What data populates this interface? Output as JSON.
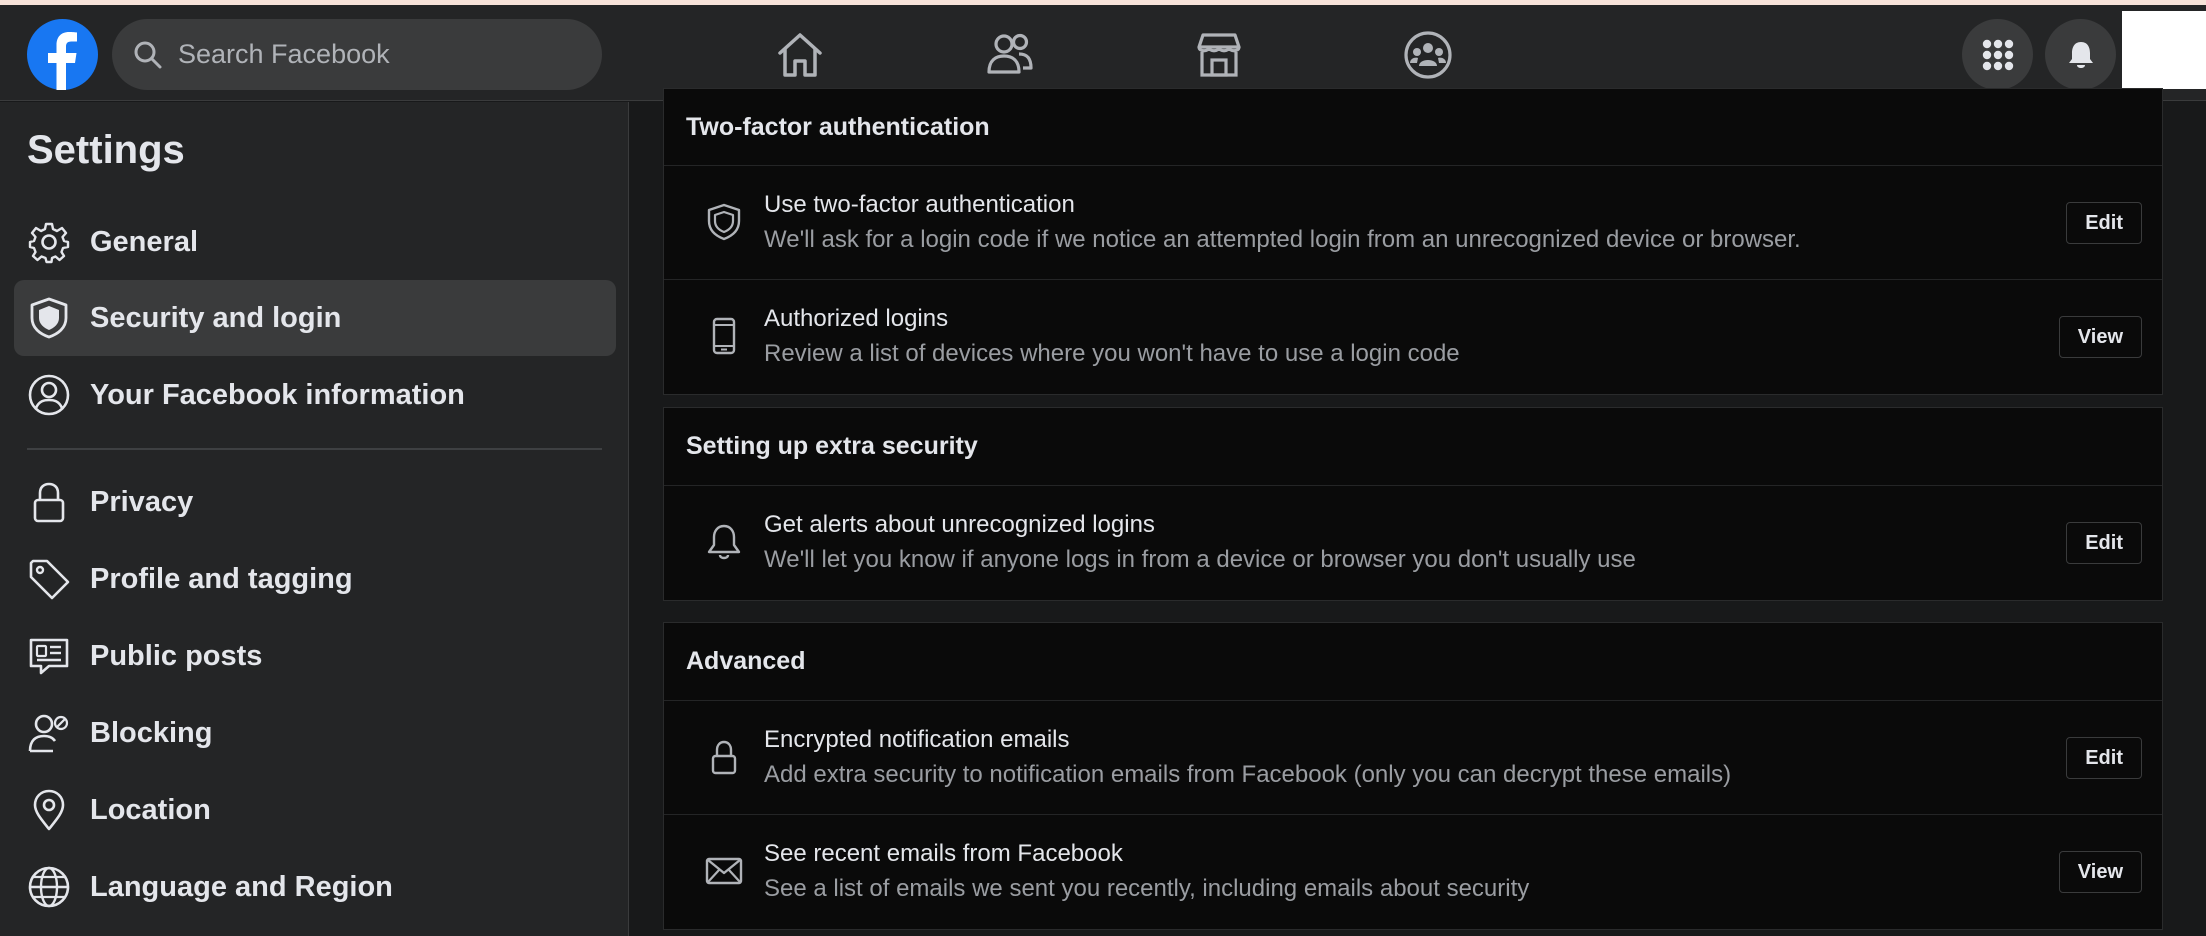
{
  "header": {
    "search_placeholder": "Search Facebook",
    "nav_icons": [
      "home-icon",
      "friends-icon",
      "marketplace-icon",
      "groups-icon"
    ],
    "right_icons": [
      "menu-grid-icon",
      "notifications-bell-icon"
    ]
  },
  "sidebar": {
    "title": "Settings",
    "items": [
      {
        "label": "General",
        "icon": "gear-icon"
      },
      {
        "label": "Security and login",
        "icon": "shield-icon",
        "active": true
      },
      {
        "label": "Your Facebook information",
        "icon": "user-circle-icon"
      },
      {
        "label": "Privacy",
        "icon": "lock-icon"
      },
      {
        "label": "Profile and tagging",
        "icon": "tag-icon"
      },
      {
        "label": "Public posts",
        "icon": "public-posts-icon"
      },
      {
        "label": "Blocking",
        "icon": "block-user-icon"
      },
      {
        "label": "Location",
        "icon": "location-pin-icon"
      },
      {
        "label": "Language and Region",
        "icon": "globe-icon"
      }
    ]
  },
  "sections": [
    {
      "title": "Two-factor authentication",
      "rows": [
        {
          "icon": "shield-icon",
          "title": "Use two-factor authentication",
          "desc": "We'll ask for a login code if we notice an attempted login from an unrecognized device or browser.",
          "button": "Edit"
        },
        {
          "icon": "phone-icon",
          "title": "Authorized logins",
          "desc": "Review a list of devices where you won't have to use a login code",
          "button": "View"
        }
      ]
    },
    {
      "title": "Setting up extra security",
      "rows": [
        {
          "icon": "bell-icon",
          "title": "Get alerts about unrecognized logins",
          "desc": "We'll let you know if anyone logs in from a device or browser you don't usually use",
          "button": "Edit"
        }
      ]
    },
    {
      "title": "Advanced",
      "rows": [
        {
          "icon": "lock-icon",
          "title": "Encrypted notification emails",
          "desc": "Add extra security to notification emails from Facebook (only you can decrypt these emails)",
          "button": "Edit"
        },
        {
          "icon": "envelope-icon",
          "title": "See recent emails from Facebook",
          "desc": "See a list of emails we sent you recently, including emails about security",
          "button": "View"
        }
      ]
    }
  ],
  "colors": {
    "brand": "#1877f2",
    "background": "#18191a",
    "surface": "#242526",
    "active_item": "#3a3b3c"
  }
}
